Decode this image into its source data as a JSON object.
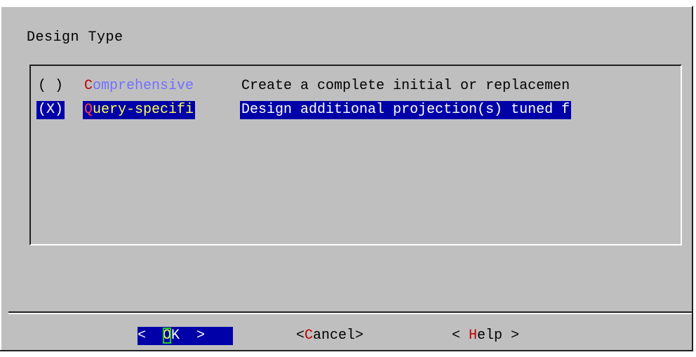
{
  "dialog": {
    "title": "Design Type"
  },
  "list": {
    "items": [
      {
        "radio": "( )",
        "tag": "Comprehensive",
        "description": "Create a complete initial or replacemen",
        "selected": false
      },
      {
        "radio": "(X)",
        "tag": "Query-specifi",
        "description": "Design additional projection(s) tuned f",
        "selected": true
      }
    ]
  },
  "buttons": {
    "ok": {
      "prefix": "<  ",
      "hotkey": "O",
      "rest": "K  >"
    },
    "cancel": {
      "prefix": "<",
      "hotkey": "C",
      "rest": "ancel>"
    },
    "help": {
      "prefix": "< ",
      "hotkey": "H",
      "rest": "elp >"
    }
  },
  "colors": {
    "background": "#c0bfc0",
    "selection": "#0000a8",
    "hotkey": "#c00000",
    "tag_unselected": "#7070ff",
    "tag_selected": "#ffff55",
    "focus_outline": "#22cc22"
  }
}
